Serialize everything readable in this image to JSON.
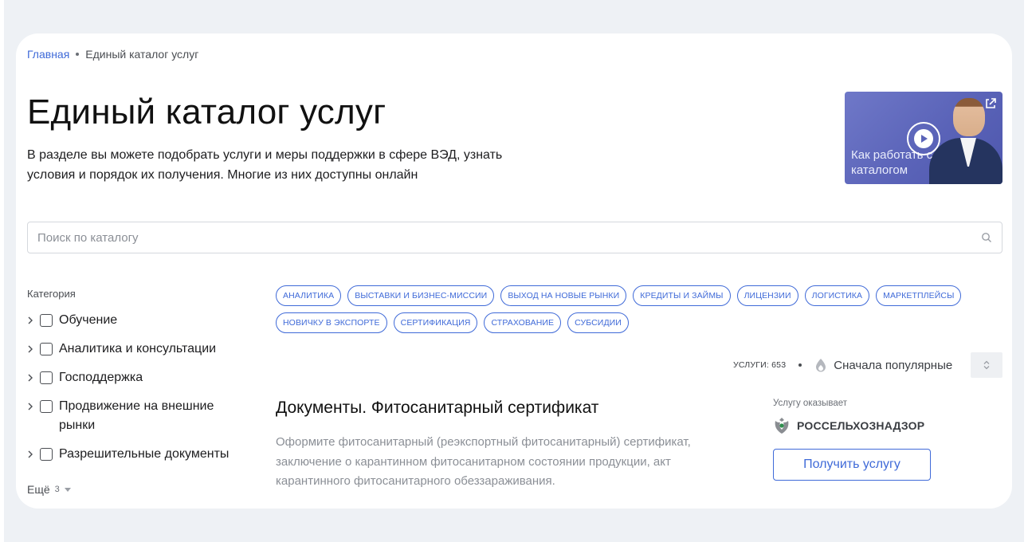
{
  "breadcrumb": {
    "home": "Главная",
    "current": "Единый каталог услуг"
  },
  "page": {
    "title": "Единый каталог услуг",
    "description": "В разделе вы можете подобрать услуги и меры поддержки в сфере ВЭД, узнать условия и порядок их получения. Многие из них доступны онлайн"
  },
  "video": {
    "caption": "Как работать с каталогом",
    "icons": [
      "play-icon",
      "external-link-icon"
    ]
  },
  "search": {
    "placeholder": "Поиск по каталогу",
    "value": ""
  },
  "categories": {
    "title": "Категория",
    "items": [
      {
        "label": "Обучение"
      },
      {
        "label": "Аналитика и консультации"
      },
      {
        "label": "Господдержка"
      },
      {
        "label": "Продвижение на внешние рынки"
      },
      {
        "label": "Разрешительные документы"
      }
    ],
    "more_label": "Ещё",
    "more_count": "3"
  },
  "tags": [
    "АНАЛИТИКА",
    "ВЫСТАВКИ И БИЗНЕС-МИССИИ",
    "ВЫХОД НА НОВЫЕ РЫНКИ",
    "КРЕДИТЫ И ЗАЙМЫ",
    "ЛИЦЕНЗИИ",
    "ЛОГИСТИКА",
    "МАРКЕТПЛЕЙСЫ",
    "НОВИЧКУ В ЭКСПОРТЕ",
    "СЕРТИФИКАЦИЯ",
    "СТРАХОВАНИЕ",
    "СУБСИДИИ"
  ],
  "services": {
    "count_label": "УСЛУГИ: 653",
    "sort_label": "Сначала популярные"
  },
  "service_card": {
    "title": "Документы. Фитосанитарный сертификат",
    "description": "Оформите фитосанитарный (реэкспортный фитосанитарный) сертификат, заключение о карантинном фитосанитарном состоянии продукции, акт карантинного фитосанитарного обеззараживания.",
    "provider_label": "Услугу оказывает",
    "provider_name": "РОССЕЛЬХОЗНАДЗОР",
    "button_label": "Получить услугу"
  },
  "colors": {
    "accent": "#3f6ad8",
    "page_background": "#eef1f5",
    "video_background": "#5a63b8",
    "muted_text": "#8b8f96"
  }
}
